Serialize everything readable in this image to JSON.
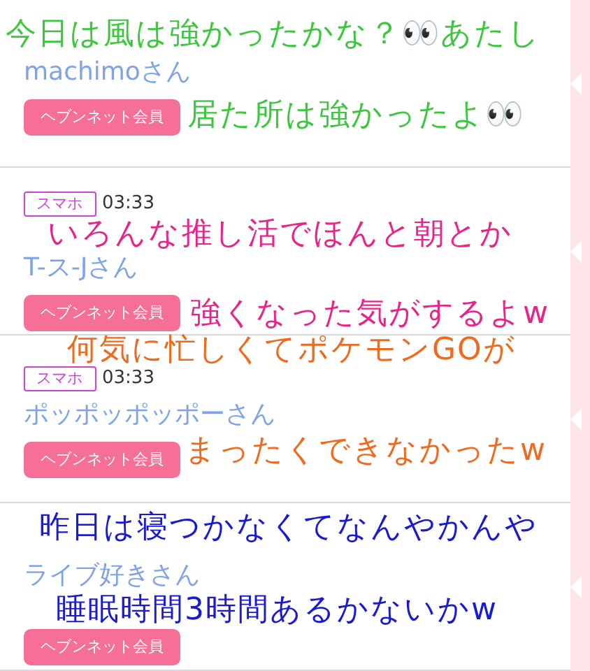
{
  "posts": [
    {
      "name": "machimoさん",
      "badge": "ヘブンネット会員",
      "overlay": [
        {
          "text": "今日は風は強かったかな？👀あたし",
          "color": "#3cc83c"
        },
        {
          "text": "居た所は強かったよ👀",
          "color": "#3cc83c"
        }
      ]
    },
    {
      "device": "スマホ",
      "time": "03:33",
      "name": "T-ス-Jさん",
      "badge": "ヘブンネット会員",
      "overlay": [
        {
          "text": "いろんな推し活でほんと朝とか",
          "color": "#e8248a"
        },
        {
          "text": "強くなった気がするよw",
          "color": "#e8248a"
        }
      ]
    },
    {
      "device": "スマホ",
      "time": "03:33",
      "name": "ポッポッポッポーさん",
      "badge": "ヘブンネット会員",
      "overlay": [
        {
          "text": "何気に忙しくてポケモンGOが",
          "color": "#f06a1e"
        },
        {
          "text": "まったくできなかったw",
          "color": "#f06a1e"
        }
      ]
    },
    {
      "name": "ライブ好きさん",
      "badge": "ヘブンネット会員",
      "overlay": [
        {
          "text": "昨日は寝つかなくてなんやかんや",
          "color": "#1a1ad0"
        },
        {
          "text": "睡眠時間3時間あるかないかw",
          "color": "#1a1ad0"
        }
      ]
    }
  ]
}
